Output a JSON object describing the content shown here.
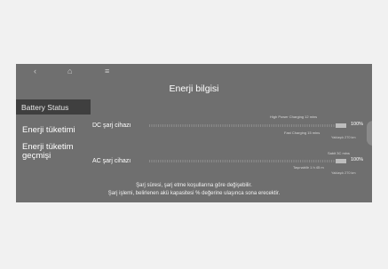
{
  "topbar": {
    "back_icon": "‹",
    "home_icon": "⌂",
    "menu_icon": "≡"
  },
  "title": "Enerji bilgisi",
  "sidebar": {
    "items": [
      {
        "label": "Battery Status"
      },
      {
        "label": "Enerji tüketimi"
      },
      {
        "label": "Enerji tüketim"
      },
      {
        "label": "geçmişi"
      }
    ]
  },
  "dc": {
    "label": "DC şarj cihazı",
    "line1": "High Power Charging 12 mins",
    "line2": "Fast Charging 15 mins",
    "percent": "100%",
    "range_tag": "Yaklaşık 270 km"
  },
  "ac": {
    "label": "AC şarj cihazı",
    "line1": "Sabit 3C mins",
    "line2": "Taşınabilir 1 h 45 m",
    "percent": "100%",
    "range_tag": "Yaklaşık 270 km"
  },
  "notes": [
    "Şarj süresi, şarj etme koşullarına göre değişebilir.",
    "Şarj işlemi, belirlenen akü kapasitesi % değerine ulaşınca sona erecektir."
  ],
  "colors": {
    "screen_bg": "#6f6f6f",
    "active_item_bg": "#3f3f3f"
  }
}
